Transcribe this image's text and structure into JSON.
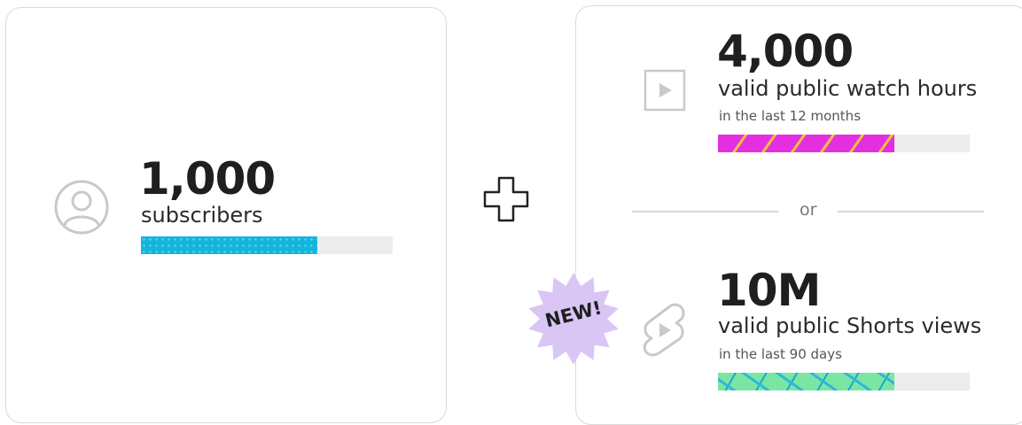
{
  "subscribers": {
    "value": "1,000",
    "label": "subscribers",
    "progress": 0.7,
    "bar_color": "#13b5dc",
    "icon": "person-icon"
  },
  "connector": {
    "icon": "plus-icon"
  },
  "watch_hours": {
    "value": "4,000",
    "label": "valid public watch hours",
    "period": "in the last 12 months",
    "progress": 0.7,
    "bar_color": "#e42fe0",
    "icon": "play-icon"
  },
  "divider": {
    "text": "or"
  },
  "shorts": {
    "badge": "NEW!",
    "badge_color": "#d9c6f5",
    "value": "10M",
    "label": "valid public Shorts views",
    "period": "in the last 90 days",
    "progress": 0.7,
    "bar_color": "#7be5a4",
    "icon": "shorts-icon"
  }
}
